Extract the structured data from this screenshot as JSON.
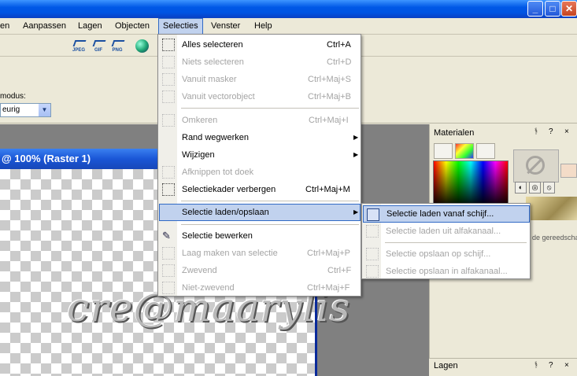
{
  "window": {
    "minimize": "_",
    "maximize": "□",
    "close": "✕"
  },
  "menubar": {
    "items": [
      "en",
      "Aanpassen",
      "Lagen",
      "Objecten",
      "Selecties",
      "Venster",
      "Help"
    ],
    "open_index": 4
  },
  "toolbar": {
    "buttons": [
      "JPEG",
      "GIF",
      "PNG"
    ],
    "globe": "globe-icon"
  },
  "options": {
    "modus_label": "modus:",
    "modus_value": "eurig"
  },
  "document": {
    "title": "@ 100% (Raster 1)",
    "watermark": "cre@maarylis"
  },
  "panel": {
    "title": "Materialen",
    "tools_text": "de gereedscha",
    "lagen_title": "Lagen"
  },
  "selecties_menu": {
    "items": [
      {
        "label": "Alles selecteren",
        "shortcut": "Ctrl+A",
        "enabled": true
      },
      {
        "label": "Niets selecteren",
        "shortcut": "Ctrl+D",
        "enabled": false
      },
      {
        "label": "Vanuit masker",
        "shortcut": "Ctrl+Maj+S",
        "enabled": false
      },
      {
        "label": "Vanuit vectorobject",
        "shortcut": "Ctrl+Maj+B",
        "enabled": false
      },
      {
        "label": "Omkeren",
        "shortcut": "Ctrl+Maj+I",
        "enabled": false
      },
      {
        "label": "Rand wegwerken",
        "shortcut": "",
        "enabled": true,
        "submenu": true
      },
      {
        "label": "Wijzigen",
        "shortcut": "",
        "enabled": true,
        "submenu": true
      },
      {
        "label": "Afknippen tot doek",
        "shortcut": "",
        "enabled": false
      },
      {
        "label": "Selectiekader verbergen",
        "shortcut": "Ctrl+Maj+M",
        "enabled": true
      },
      {
        "label": "Selectie laden/opslaan",
        "shortcut": "",
        "enabled": true,
        "submenu": true,
        "highlighted": true
      },
      {
        "label": "Selectie bewerken",
        "shortcut": "",
        "enabled": true
      },
      {
        "label": "Laag maken van selectie",
        "shortcut": "Ctrl+Maj+P",
        "enabled": false
      },
      {
        "label": "Zwevend",
        "shortcut": "Ctrl+F",
        "enabled": false
      },
      {
        "label": "Niet-zwevend",
        "shortcut": "Ctrl+Maj+F",
        "enabled": false
      }
    ]
  },
  "submenu": {
    "items": [
      {
        "label": "Selectie laden vanaf schijf...",
        "enabled": true,
        "highlighted": true
      },
      {
        "label": "Selectie laden uit alfakanaal...",
        "enabled": false
      },
      {
        "label": "Selectie opslaan op schijf...",
        "enabled": false
      },
      {
        "label": "Selectie opslaan in alfakanaal...",
        "enabled": false
      }
    ]
  },
  "colors": {
    "titlebar": "#0054e3",
    "highlight": "#c1d2ee",
    "highlight_border": "#316ac5",
    "disabled_text": "#a4a4a4"
  }
}
